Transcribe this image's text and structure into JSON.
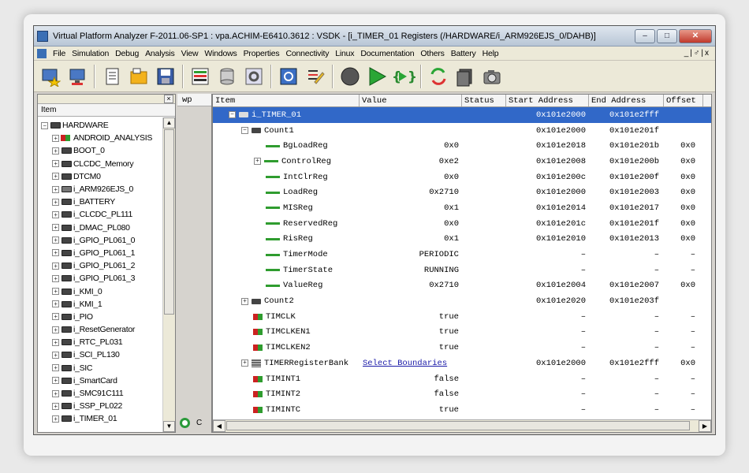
{
  "window": {
    "title": "Virtual Platform Analyzer F-2011.06-SP1 : vpa.ACHIM-E6410.3612 : VSDK - [i_TIMER_01 Registers (/HARDWARE/i_ARM926EJS_0/DAHB)]",
    "minimize": "–",
    "maximize": "□",
    "close": "✕"
  },
  "menu": {
    "items": [
      "File",
      "Simulation",
      "Debug",
      "Analysis",
      "View",
      "Windows",
      "Properties",
      "Connectivity",
      "Linux",
      "Documentation",
      "Others",
      "Battery",
      "Help"
    ],
    "mdi_controls": "_|♂|x"
  },
  "toolbar": {
    "buttons": [
      "favorites-icon",
      "network-icon",
      "document-icon",
      "open-folder-icon",
      "save-icon",
      "layout-icon",
      "database-icon",
      "settings-icon",
      "refresh-icon",
      "edit-icon",
      "stop-icon",
      "play-icon",
      "step-icon",
      "sync-icon",
      "layers-icon",
      "camera-icon"
    ]
  },
  "left_panel": {
    "close": "×",
    "column_header": "Item",
    "tree": [
      {
        "label": "HARDWARE",
        "level": 0,
        "expander": "−",
        "icon": "chip"
      },
      {
        "label": "ANDROID_ANALYSIS",
        "level": 1,
        "expander": "+",
        "icon": "pin"
      },
      {
        "label": "BOOT_0",
        "level": 1,
        "expander": "+",
        "icon": "chip"
      },
      {
        "label": "CLCDC_Memory",
        "level": 1,
        "expander": "+",
        "icon": "chip"
      },
      {
        "label": "DTCM0",
        "level": 1,
        "expander": "+",
        "icon": "chip"
      },
      {
        "label": "i_ARM926EJS_0",
        "level": 1,
        "expander": "+",
        "icon": "cpu"
      },
      {
        "label": "i_BATTERY",
        "level": 1,
        "expander": "+",
        "icon": "chip"
      },
      {
        "label": "i_CLCDC_PL111",
        "level": 1,
        "expander": "+",
        "icon": "chip"
      },
      {
        "label": "i_DMAC_PL080",
        "level": 1,
        "expander": "+",
        "icon": "chip"
      },
      {
        "label": "i_GPIO_PL061_0",
        "level": 1,
        "expander": "+",
        "icon": "chip"
      },
      {
        "label": "i_GPIO_PL061_1",
        "level": 1,
        "expander": "+",
        "icon": "chip"
      },
      {
        "label": "i_GPIO_PL061_2",
        "level": 1,
        "expander": "+",
        "icon": "chip"
      },
      {
        "label": "i_GPIO_PL061_3",
        "level": 1,
        "expander": "+",
        "icon": "chip"
      },
      {
        "label": "i_KMI_0",
        "level": 1,
        "expander": "+",
        "icon": "chip"
      },
      {
        "label": "i_KMI_1",
        "level": 1,
        "expander": "+",
        "icon": "chip"
      },
      {
        "label": "i_PIO",
        "level": 1,
        "expander": "+",
        "icon": "chip"
      },
      {
        "label": "i_ResetGenerator",
        "level": 1,
        "expander": "+",
        "icon": "chip"
      },
      {
        "label": "i_RTC_PL031",
        "level": 1,
        "expander": "+",
        "icon": "chip"
      },
      {
        "label": "i_SCI_PL130",
        "level": 1,
        "expander": "+",
        "icon": "chip"
      },
      {
        "label": "i_SIC",
        "level": 1,
        "expander": "+",
        "icon": "chip"
      },
      {
        "label": "i_SmartCard",
        "level": 1,
        "expander": "+",
        "icon": "chip"
      },
      {
        "label": "i_SMC91C111",
        "level": 1,
        "expander": "+",
        "icon": "chip"
      },
      {
        "label": "i_SSP_PL022",
        "level": 1,
        "expander": "+",
        "icon": "chip"
      },
      {
        "label": "i_TIMER_01",
        "level": 1,
        "expander": "+",
        "icon": "chip"
      }
    ]
  },
  "wp_panel": {
    "header": "wp",
    "footer_label": "C"
  },
  "grid": {
    "columns": [
      "Item",
      "Value",
      "Status",
      "Start Address",
      "End Address",
      "Offset"
    ],
    "rows": [
      {
        "indent": 0,
        "expander": "−",
        "icon": "chip",
        "item": "i_TIMER_01",
        "value": "",
        "status": "",
        "start": "0x101e2000",
        "end": "0x101e2fff",
        "offset": "",
        "selected": true
      },
      {
        "indent": 1,
        "expander": "−",
        "icon": "chip",
        "item": "Count1",
        "value": "",
        "status": "",
        "start": "0x101e2000",
        "end": "0x101e201f",
        "offset": ""
      },
      {
        "indent": 2,
        "expander": "",
        "icon": "dash",
        "item": "BgLoadReg",
        "value": "0x0",
        "status": "",
        "start": "0x101e2018",
        "end": "0x101e201b",
        "offset": "0x0"
      },
      {
        "indent": 2,
        "expander": "+",
        "icon": "dash",
        "item": "ControlReg",
        "value": "0xe2",
        "status": "",
        "start": "0x101e2008",
        "end": "0x101e200b",
        "offset": "0x0"
      },
      {
        "indent": 2,
        "expander": "",
        "icon": "dash",
        "item": "IntClrReg",
        "value": "0x0",
        "status": "",
        "start": "0x101e200c",
        "end": "0x101e200f",
        "offset": "0x0"
      },
      {
        "indent": 2,
        "expander": "",
        "icon": "dash",
        "item": "LoadReg",
        "value": "0x2710",
        "status": "",
        "start": "0x101e2000",
        "end": "0x101e2003",
        "offset": "0x0"
      },
      {
        "indent": 2,
        "expander": "",
        "icon": "dash",
        "item": "MISReg",
        "value": "0x1",
        "status": "",
        "start": "0x101e2014",
        "end": "0x101e2017",
        "offset": "0x0"
      },
      {
        "indent": 2,
        "expander": "",
        "icon": "dash",
        "item": "ReservedReg",
        "value": "0x0",
        "status": "",
        "start": "0x101e201c",
        "end": "0x101e201f",
        "offset": "0x0"
      },
      {
        "indent": 2,
        "expander": "",
        "icon": "dash",
        "item": "RisReg",
        "value": "0x1",
        "status": "",
        "start": "0x101e2010",
        "end": "0x101e2013",
        "offset": "0x0"
      },
      {
        "indent": 2,
        "expander": "",
        "icon": "dash",
        "item": "TimerMode",
        "value": "PERIODIC",
        "status": "",
        "start": "–",
        "end": "–",
        "offset": "–"
      },
      {
        "indent": 2,
        "expander": "",
        "icon": "dash",
        "item": "TimerState",
        "value": "RUNNING",
        "status": "",
        "start": "–",
        "end": "–",
        "offset": "–"
      },
      {
        "indent": 2,
        "expander": "",
        "icon": "dash",
        "item": "ValueReg",
        "value": "0x2710",
        "status": "",
        "start": "0x101e2004",
        "end": "0x101e2007",
        "offset": "0x0"
      },
      {
        "indent": 1,
        "expander": "+",
        "icon": "chip",
        "item": "Count2",
        "value": "",
        "status": "",
        "start": "0x101e2020",
        "end": "0x101e203f",
        "offset": ""
      },
      {
        "indent": 1,
        "expander": "",
        "icon": "pin",
        "item": "TIMCLK",
        "value": "true",
        "status": "",
        "start": "–",
        "end": "–",
        "offset": "–"
      },
      {
        "indent": 1,
        "expander": "",
        "icon": "pin",
        "item": "TIMCLKEN1",
        "value": "true",
        "status": "",
        "start": "–",
        "end": "–",
        "offset": "–"
      },
      {
        "indent": 1,
        "expander": "",
        "icon": "pin",
        "item": "TIMCLKEN2",
        "value": "true",
        "status": "",
        "start": "–",
        "end": "–",
        "offset": "–"
      },
      {
        "indent": 1,
        "expander": "+",
        "icon": "bank",
        "item": "TIMERRegisterBank",
        "value": "Select Boundaries",
        "link": true,
        "status": "",
        "start": "0x101e2000",
        "end": "0x101e2fff",
        "offset": "0x0"
      },
      {
        "indent": 1,
        "expander": "",
        "icon": "pin",
        "item": "TIMINT1",
        "value": "false",
        "status": "",
        "start": "–",
        "end": "–",
        "offset": "–"
      },
      {
        "indent": 1,
        "expander": "",
        "icon": "pin",
        "item": "TIMINT2",
        "value": "false",
        "status": "",
        "start": "–",
        "end": "–",
        "offset": "–"
      },
      {
        "indent": 1,
        "expander": "",
        "icon": "pin",
        "item": "TIMINTC",
        "value": "true",
        "status": "",
        "start": "–",
        "end": "–",
        "offset": "–"
      }
    ]
  },
  "colors": {
    "selection": "#3168c8",
    "link": "#1a1aa8",
    "register_dash": "#2f9c2f"
  }
}
